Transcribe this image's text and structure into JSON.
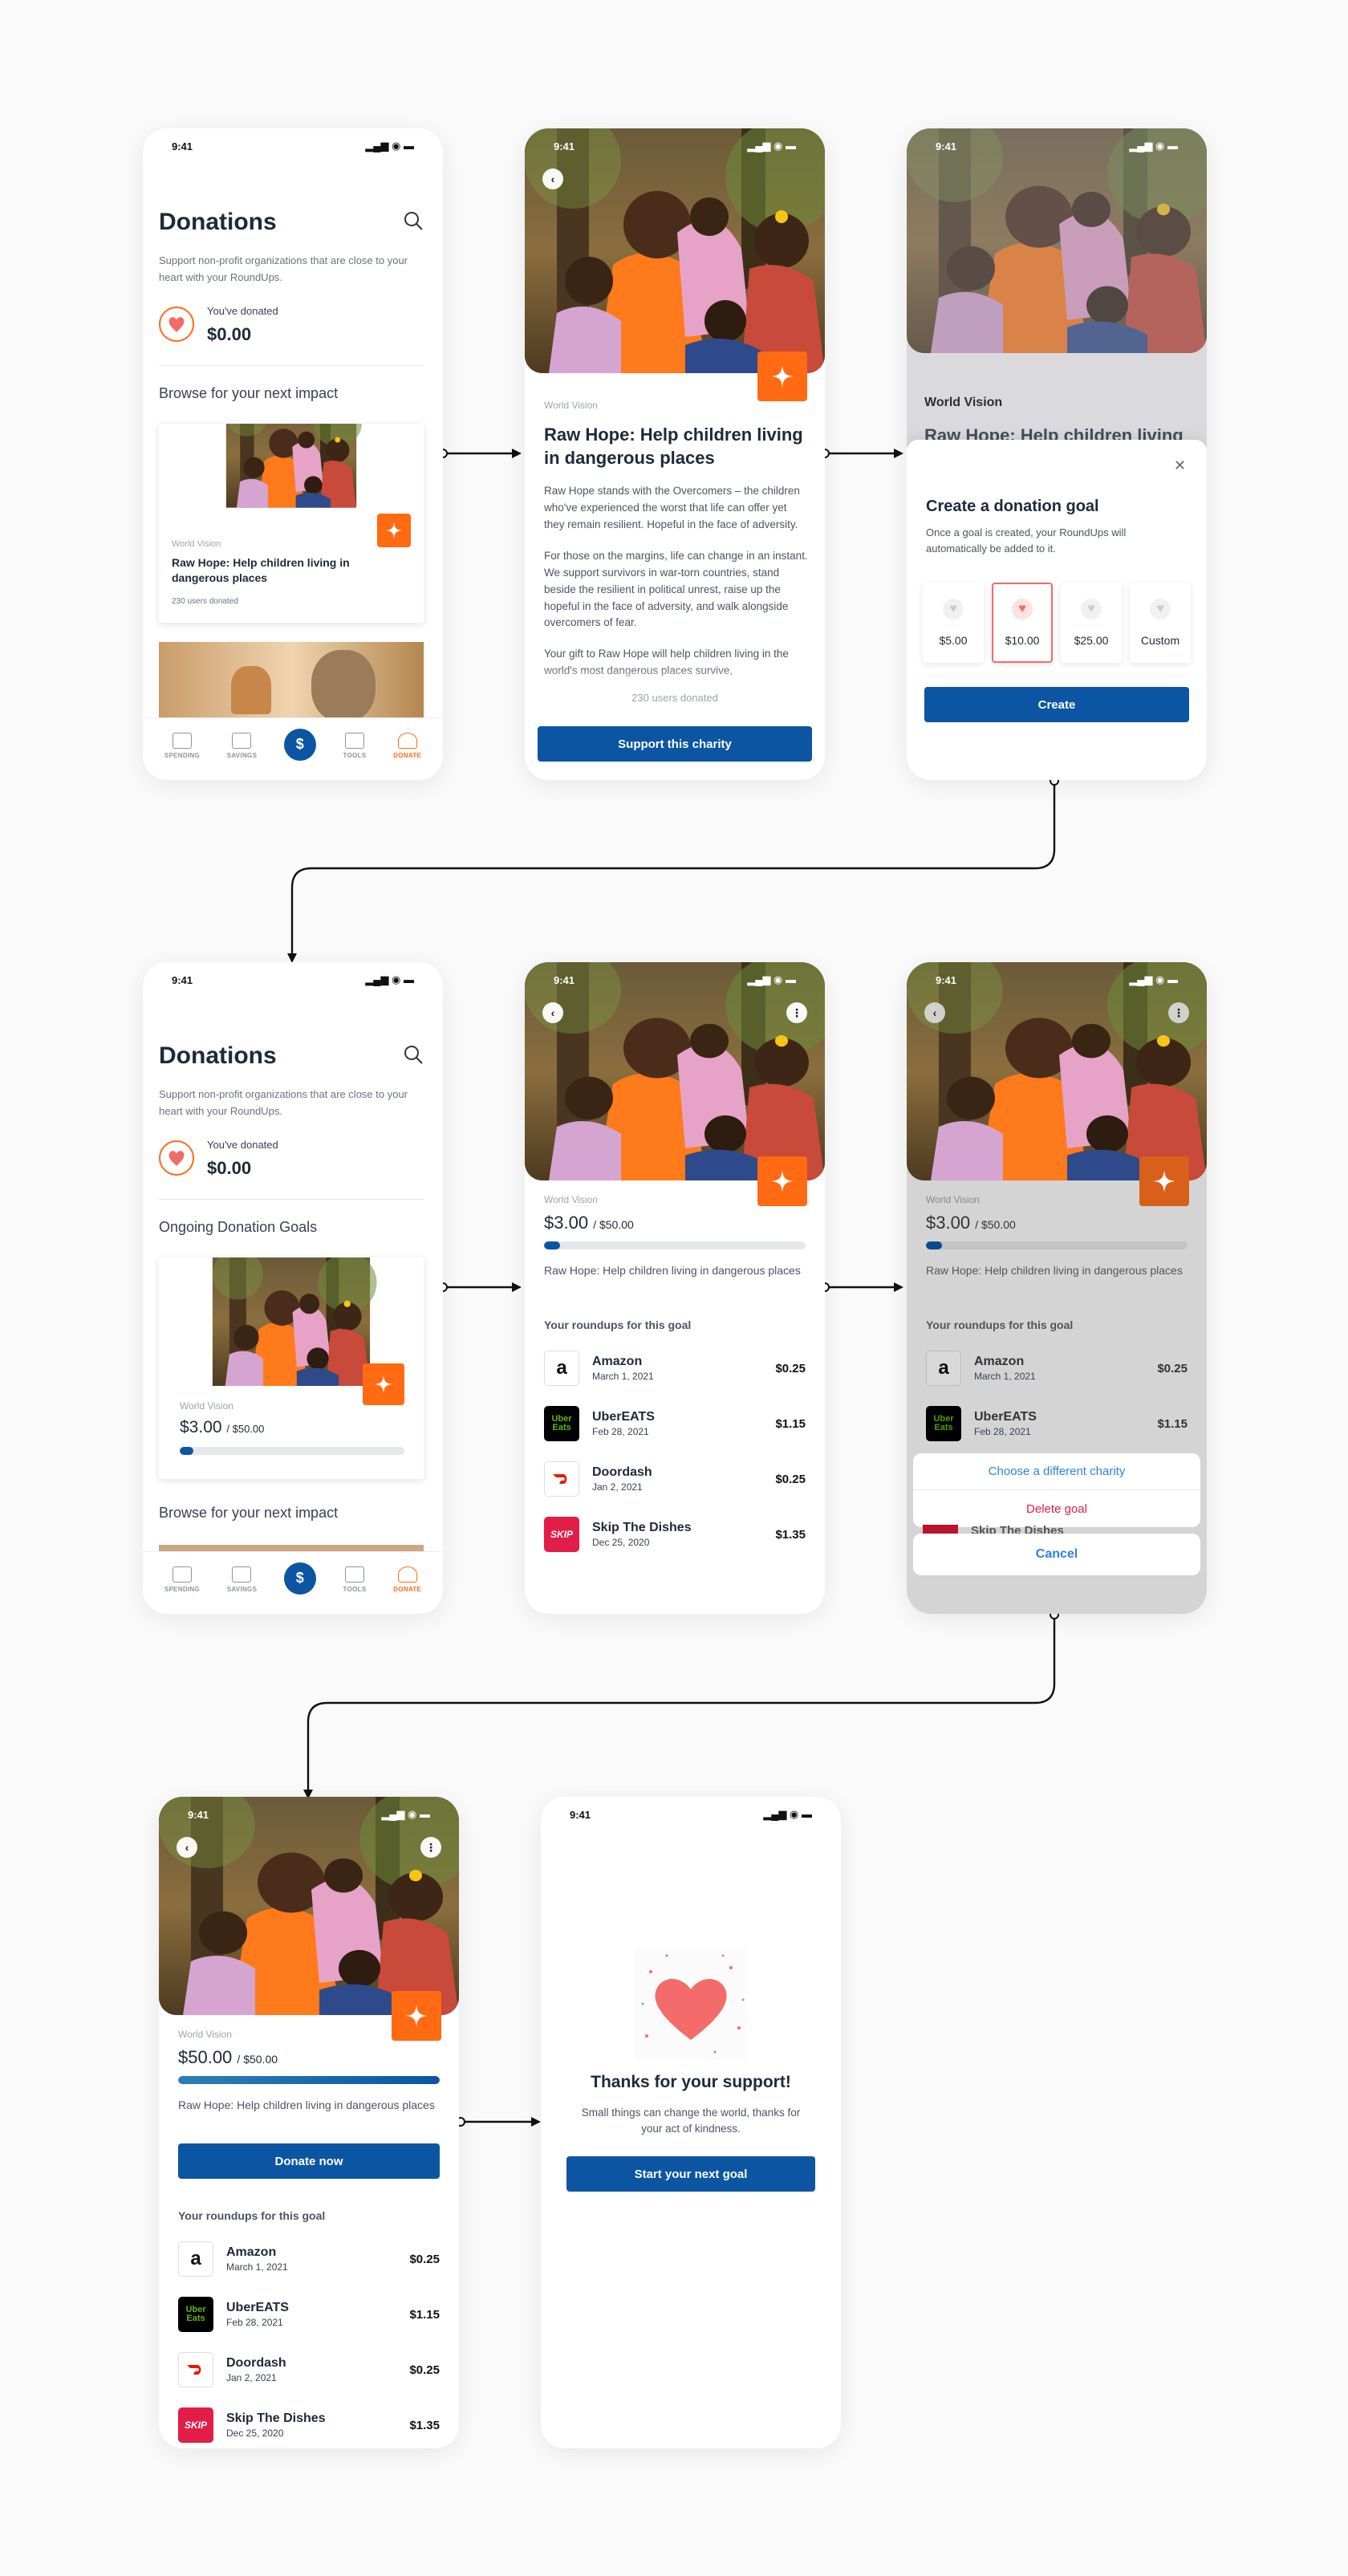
{
  "status_time": "9:41",
  "donations": {
    "title": "Donations",
    "subtitle": "Support non-profit organizations that are close to your heart with your RoundUps.",
    "donated_label": "You've donated",
    "donated_amount": "$0.00",
    "browse_heading": "Browse for your next impact",
    "ongoing_heading": "Ongoing Donation Goals"
  },
  "charity": {
    "org": "World Vision",
    "title": "Raw Hope: Help children living in dangerous places",
    "title_short": "Raw Hope: Help children living in dangerous places",
    "users_donated": "230 users donated",
    "para1": "Raw Hope stands with the Overcomers – the children who've experienced the worst that life can offer yet they remain resilient. Hopeful in the face of adversity.",
    "para2": "For those on the margins, life can change in an instant. We support survivors in war-torn countries, stand beside the resilient in political unrest, raise up the hopeful in the face of adversity, and walk alongside overcomers of fear.",
    "para3": "Your gift to Raw Hope will help children living in the world's most dangerous places survive,",
    "support_btn": "Support this charity",
    "bg_title": "Raw Hope: Help children living"
  },
  "goal_modal": {
    "title": "Create a donation goal",
    "desc": "Once a goal is created, your RoundUps will automatically be added to it.",
    "options": [
      "$5.00",
      "$10.00",
      "$25.00",
      "Custom"
    ],
    "selected_index": 1,
    "create_btn": "Create"
  },
  "goal": {
    "amount": "$3.00",
    "target": "/ $50.00",
    "progress_fraction": 0.06,
    "full_amount": "$50.00",
    "full_fraction": 1.0,
    "roundups_heading": "Your roundups for this goal",
    "donate_now": "Donate now"
  },
  "roundups": [
    {
      "name": "Amazon",
      "date": "March 1, 2021",
      "amount": "$0.25",
      "logo": "a"
    },
    {
      "name": "UberEATS",
      "date": "Feb 28, 2021",
      "amount": "$1.15",
      "logo": "Uber Eats"
    },
    {
      "name": "Doordash",
      "date": "Jan 2, 2021",
      "amount": "$0.25",
      "logo": "doordash-icon"
    },
    {
      "name": "Skip The Dishes",
      "date": "Dec 25, 2020",
      "amount": "$1.35",
      "logo": "SKIP"
    }
  ],
  "action_sheet": {
    "choose": "Choose a different charity",
    "delete": "Delete goal",
    "cancel": "Cancel",
    "peek": "Skip The Dishes"
  },
  "thanks": {
    "title": "Thanks for your support!",
    "body": "Small things can change the world, thanks for your act of kindness.",
    "btn": "Start your next goal"
  },
  "tabs": [
    "SPENDING",
    "SAVINGS",
    "$",
    "TOOLS",
    "DONATE"
  ],
  "colors": {
    "accent": "#ff6a13",
    "primary": "#0b55a3",
    "danger": "#e11d48",
    "link": "#2f80ed"
  }
}
